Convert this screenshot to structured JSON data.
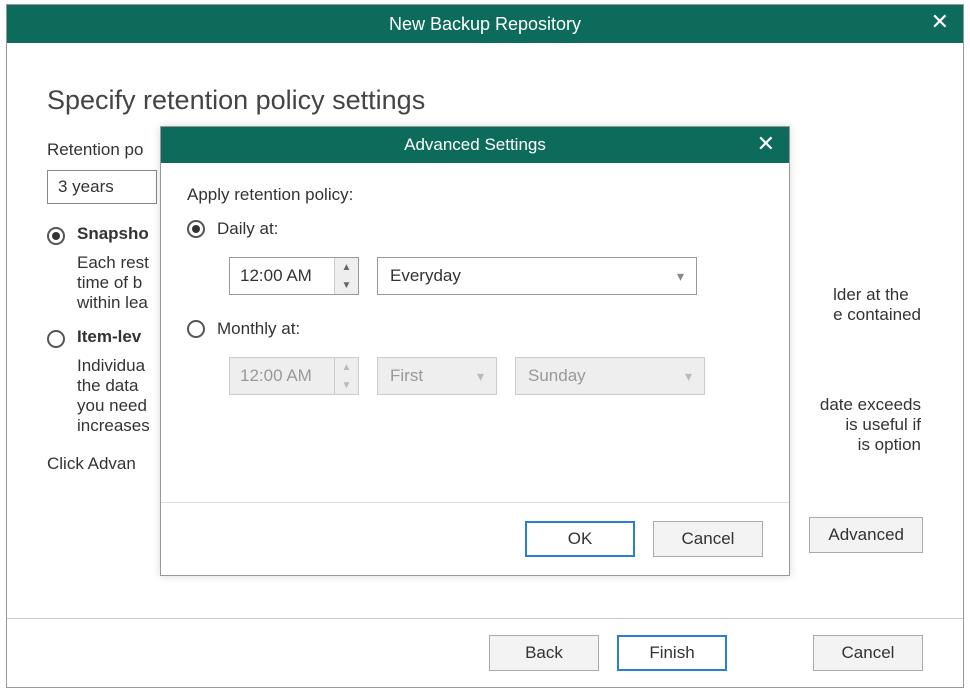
{
  "window": {
    "title": "New Backup Repository"
  },
  "page": {
    "heading": "Specify retention policy settings",
    "retention_label_fragment": "Retention po",
    "retention_value": "3 years",
    "option1": {
      "title_fragment": "Snapsho",
      "line1": "Each rest",
      "line2": "time of b",
      "line3": "within lea",
      "tail1": "lder at the",
      "tail2": "e contained"
    },
    "option2": {
      "title_fragment": "Item-lev",
      "line1": "Individua",
      "line2": "the data",
      "line3": "you need",
      "line4": "increases",
      "tail1": "date exceeds",
      "tail2": "is useful if",
      "tail3": "is option"
    },
    "hint_fragment": "Click Advan",
    "advanced_button": "Advanced"
  },
  "footer": {
    "back": "Back",
    "finish": "Finish",
    "cancel": "Cancel"
  },
  "modal": {
    "title": "Advanced Settings",
    "apply_label": "Apply retention policy:",
    "daily_label": "Daily at:",
    "monthly_label": "Monthly at:",
    "daily_time": "12:00 AM",
    "daily_day": "Everyday",
    "monthly_time": "12:00 AM",
    "monthly_ord": "First",
    "monthly_day": "Sunday",
    "ok": "OK",
    "cancel": "Cancel"
  }
}
